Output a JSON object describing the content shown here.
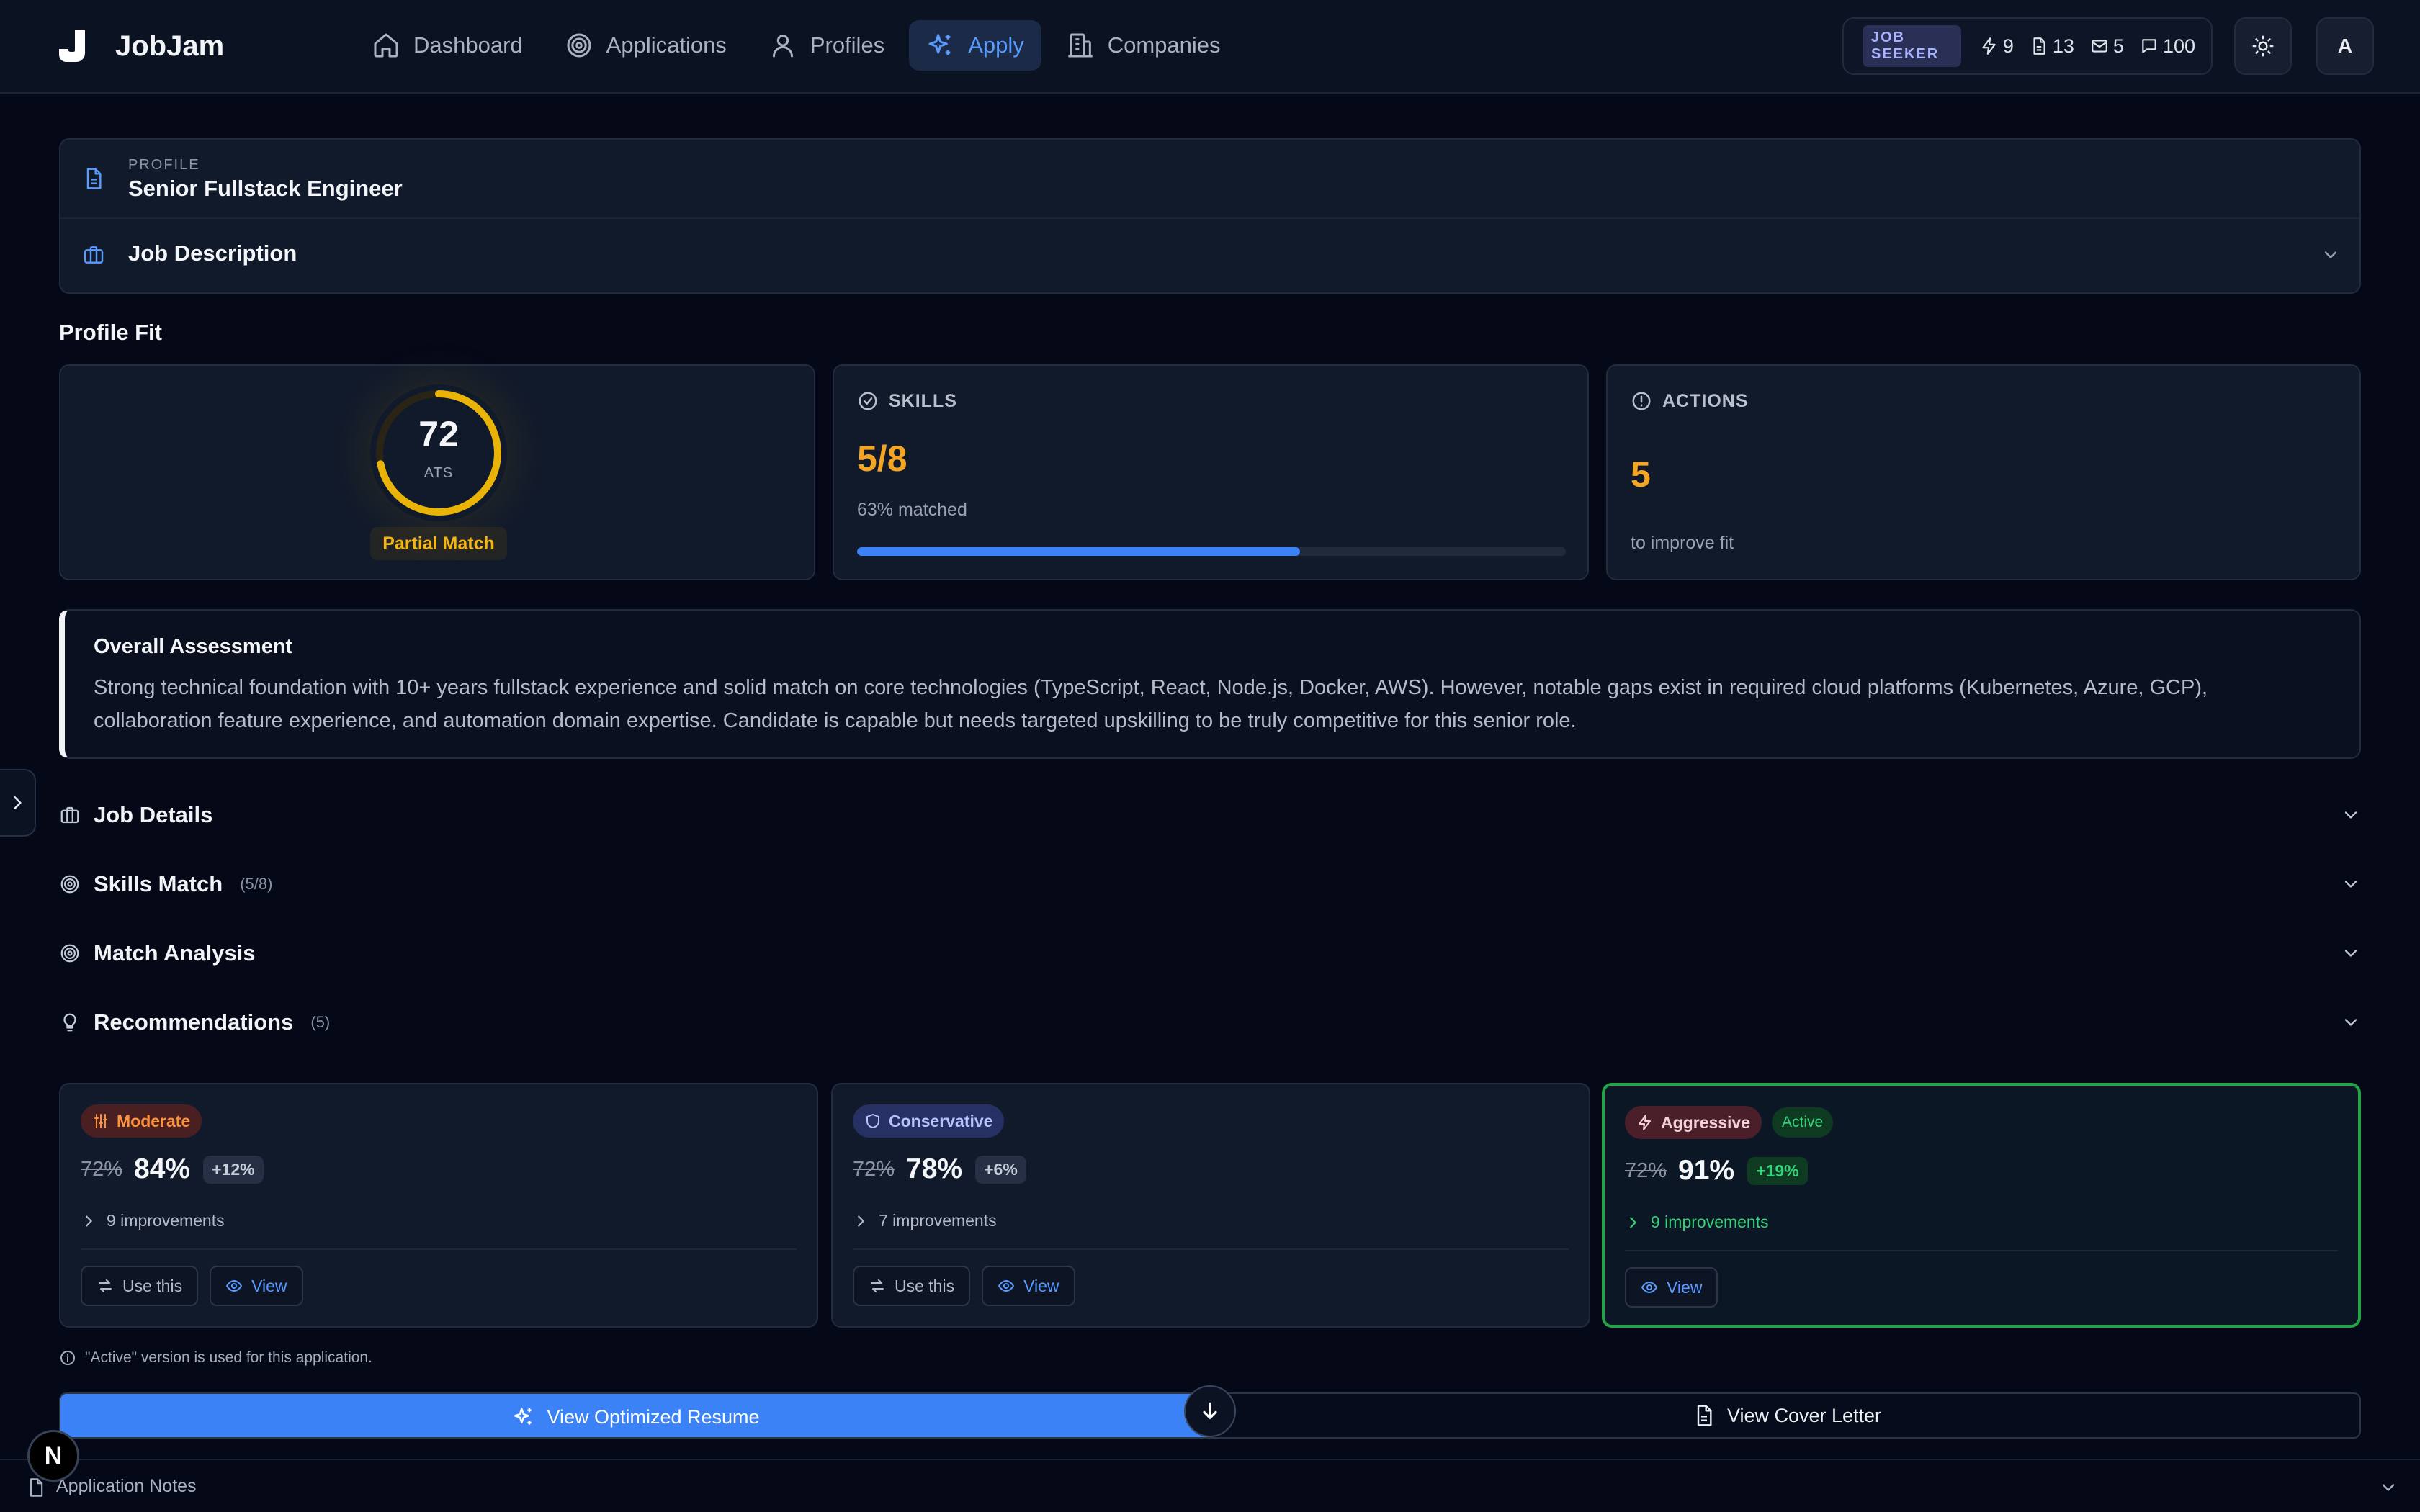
{
  "app": {
    "name": "JobJam"
  },
  "nav": {
    "items": [
      {
        "label": "Dashboard",
        "icon": "home-icon"
      },
      {
        "label": "Applications",
        "icon": "target-icon"
      },
      {
        "label": "Profiles",
        "icon": "user-icon"
      },
      {
        "label": "Apply",
        "icon": "sparkles-icon",
        "active": true
      },
      {
        "label": "Companies",
        "icon": "building-icon"
      }
    ]
  },
  "header": {
    "role": "JOB SEEKER",
    "stats": {
      "credits": "9",
      "documents": "13",
      "messages": "5",
      "comments": "100"
    },
    "avatar_initial": "A"
  },
  "profile": {
    "label": "PROFILE",
    "name": "Senior Fullstack Engineer"
  },
  "job_description": {
    "label": "Job Description"
  },
  "profile_fit": {
    "title": "Profile Fit",
    "ats": {
      "score": "72",
      "score_value": 72,
      "label": "ATS",
      "match_label": "Partial Match"
    },
    "skills": {
      "heading": "SKILLS",
      "value": "5/8",
      "matched_text": "63% matched",
      "matched_fraction": 0.625
    },
    "actions": {
      "heading": "ACTIONS",
      "value": "5",
      "caption": "to improve fit"
    }
  },
  "assessment": {
    "title": "Overall Assessment",
    "text": "Strong technical foundation with 10+ years fullstack experience and solid match on core technologies (TypeScript, React, Node.js, Docker, AWS). However, notable gaps exist in required cloud platforms (Kubernetes, Azure, GCP), collaboration feature experience, and automation domain expertise. Candidate is capable but needs targeted upskilling to be truly competitive for this senior role."
  },
  "sections": {
    "job_details": {
      "label": "Job Details"
    },
    "skills_match": {
      "label": "Skills Match",
      "count": "(5/8)"
    },
    "match_analysis": {
      "label": "Match Analysis"
    },
    "recommendations": {
      "label": "Recommendations",
      "count": "(5)"
    }
  },
  "variants": [
    {
      "name": "Moderate",
      "old": "72%",
      "new": "84%",
      "delta": "+12%",
      "improvements": "9 improvements",
      "use_label": "Use this",
      "view_label": "View"
    },
    {
      "name": "Conservative",
      "old": "72%",
      "new": "78%",
      "delta": "+6%",
      "improvements": "7 improvements",
      "use_label": "Use this",
      "view_label": "View"
    },
    {
      "name": "Aggressive",
      "active_label": "Active",
      "old": "72%",
      "new": "91%",
      "delta": "+19%",
      "improvements": "9 improvements",
      "view_label": "View"
    }
  ],
  "note": "\"Active\" version is used for this application.",
  "buttons": {
    "optimized_resume": "View Optimized Resume",
    "cover_letter": "View Cover Letter"
  },
  "footer": {
    "notes_label": "Application Notes",
    "badge": "N"
  },
  "colors": {
    "background": "#040817",
    "accent": "#3b82f6",
    "score_yellow": "#eab308",
    "warning": "#f5a524",
    "success": "#22a546"
  }
}
